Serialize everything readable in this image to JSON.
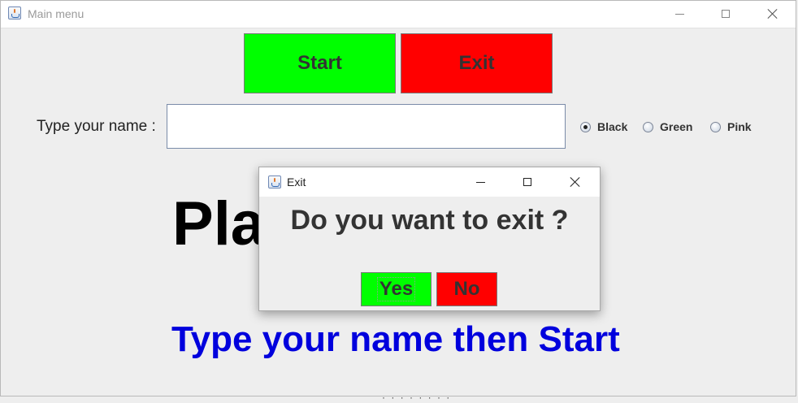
{
  "main_window": {
    "title": "Main menu",
    "start_label": "Start",
    "exit_label": "Exit",
    "name_label": "Type your name :",
    "name_value": "",
    "color_options": [
      {
        "label": "Black",
        "selected": true
      },
      {
        "label": "Green",
        "selected": false
      },
      {
        "label": "Pink",
        "selected": false
      }
    ],
    "play_text": "Pla",
    "hint_text": "Type your name then Start",
    "bottom_fragment": "· ·  · · · · · ·"
  },
  "dialog": {
    "title": "Exit",
    "message": "Do you want to exit ?",
    "yes_label": "Yes",
    "no_label": "No"
  },
  "colors": {
    "start_button": "#00ff00",
    "exit_button": "#ff0000",
    "yes_button": "#00ff00",
    "no_button": "#ff0000",
    "hint_text": "#0000dd",
    "background": "#eeeeee"
  },
  "icons": {
    "app": "java-cup-icon",
    "minimize": "minimize-icon",
    "maximize": "maximize-icon",
    "close": "close-icon"
  }
}
